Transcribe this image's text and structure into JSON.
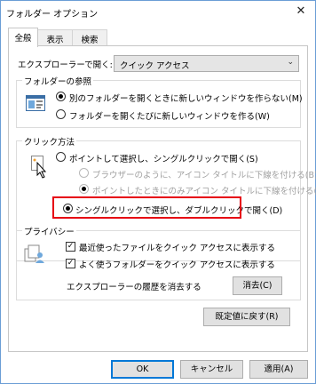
{
  "window": {
    "title": "フォルダー オプション",
    "close_glyph": "✕"
  },
  "tabs": [
    {
      "label": "全般",
      "active": true
    },
    {
      "label": "表示",
      "active": false
    },
    {
      "label": "検索",
      "active": false
    }
  ],
  "explorer_open": {
    "label": "エクスプローラーで開く:",
    "value": "クイック アクセス"
  },
  "browse_folders": {
    "title": "フォルダーの参照",
    "options": [
      {
        "label": "別のフォルダーを開くときに新しいウィンドウを作らない(M)",
        "checked": true
      },
      {
        "label": "フォルダーを開くたびに新しいウィンドウを作る(W)",
        "checked": false
      }
    ]
  },
  "click_method": {
    "title": "クリック方法",
    "options": [
      {
        "label": "ポイントして選択し、シングルクリックで開く(S)",
        "checked": false,
        "disabled": false
      },
      {
        "label": "ブラウザーのように、アイコン タイトルに下線を付ける(B)",
        "checked": false,
        "disabled": true
      },
      {
        "label": "ポイントしたときにのみアイコン タイトルに下線を付ける(P)",
        "checked": true,
        "disabled": true
      },
      {
        "label": "シングルクリックで選択し、ダブルクリックで開く(D)",
        "checked": true,
        "disabled": false
      }
    ],
    "highlight_color": "#e60012"
  },
  "privacy": {
    "title": "プライバシー",
    "options": [
      {
        "label": "最近使ったファイルをクイック アクセスに表示する",
        "checked": true
      },
      {
        "label": "よく使うフォルダーをクイック アクセスに表示する",
        "checked": true
      }
    ],
    "clear_history_label": "エクスプローラーの履歴を消去する",
    "clear_button": "消去(C)"
  },
  "restore_defaults": "既定値に戻す(R)",
  "footer": {
    "ok": "OK",
    "cancel": "キャンセル",
    "apply": "適用(A)"
  },
  "accent_color": "#0078d7"
}
